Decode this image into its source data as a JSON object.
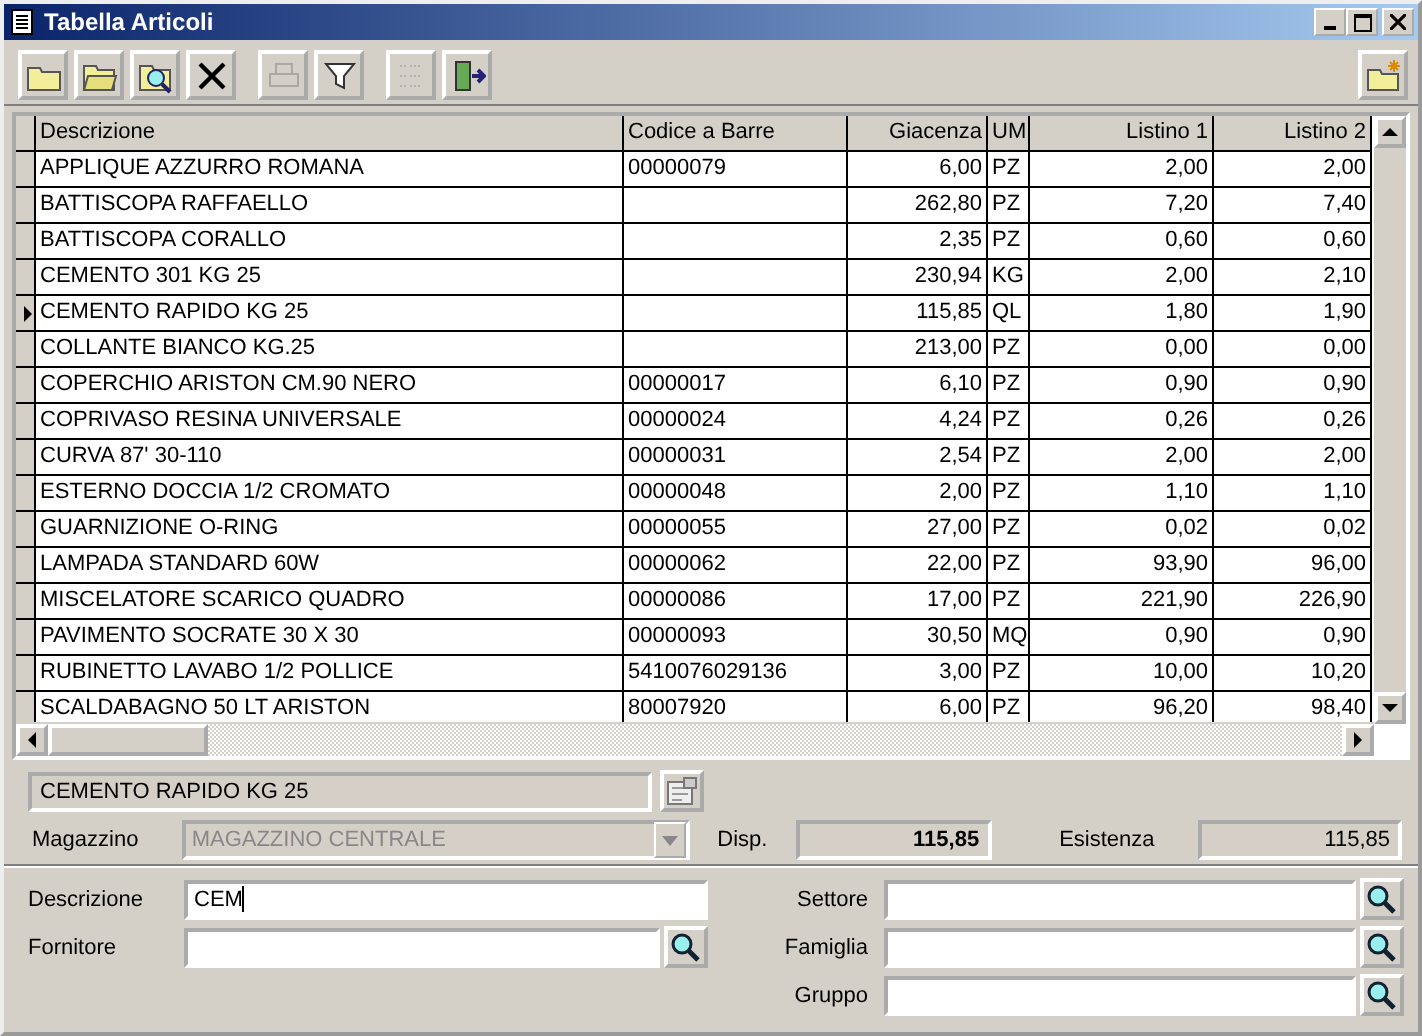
{
  "window": {
    "title": "Tabella Articoli"
  },
  "toolbar": [
    {
      "kind": "new",
      "disabled": false
    },
    {
      "kind": "open",
      "disabled": false
    },
    {
      "kind": "search",
      "disabled": false
    },
    {
      "kind": "delete",
      "disabled": false
    },
    {
      "kind": "print",
      "disabled": true
    },
    {
      "kind": "filter",
      "disabled": false
    },
    {
      "kind": "list",
      "disabled": true
    },
    {
      "kind": "exit",
      "disabled": false
    }
  ],
  "grid": {
    "columns": [
      {
        "label": "Descrizione"
      },
      {
        "label": "Codice a Barre"
      },
      {
        "label": "Giacenza"
      },
      {
        "label": "UM"
      },
      {
        "label": "Listino 1"
      },
      {
        "label": "Listino 2"
      }
    ],
    "rows": [
      {
        "selected": false,
        "cells": [
          "APPLIQUE AZZURRO ROMANA",
          "00000079",
          "6,00",
          "PZ",
          "2,00",
          "2,00"
        ]
      },
      {
        "selected": false,
        "cells": [
          "BATTISCOPA  RAFFAELLO",
          "",
          "262,80",
          "PZ",
          "7,20",
          "7,40"
        ]
      },
      {
        "selected": false,
        "cells": [
          "BATTISCOPA CORALLO",
          "",
          "2,35",
          "PZ",
          "0,60",
          "0,60"
        ]
      },
      {
        "selected": false,
        "cells": [
          "CEMENTO 301 KG 25",
          "",
          "230,94",
          "KG",
          "2,00",
          "2,10"
        ]
      },
      {
        "selected": true,
        "cells": [
          "CEMENTO RAPIDO KG 25",
          "",
          "115,85",
          "QL",
          "1,80",
          "1,90"
        ]
      },
      {
        "selected": false,
        "cells": [
          "COLLANTE BIANCO KG.25",
          "",
          "213,00",
          "PZ",
          "0,00",
          "0,00"
        ]
      },
      {
        "selected": false,
        "cells": [
          "COPERCHIO ARISTON CM.90 NERO",
          "00000017",
          "6,10",
          "PZ",
          "0,90",
          "0,90"
        ]
      },
      {
        "selected": false,
        "cells": [
          "COPRIVASO RESINA UNIVERSALE",
          "00000024",
          "4,24",
          "PZ",
          "0,26",
          "0,26"
        ]
      },
      {
        "selected": false,
        "cells": [
          "CURVA 87' 30-110",
          "00000031",
          "2,54",
          "PZ",
          "2,00",
          "2,00"
        ]
      },
      {
        "selected": false,
        "cells": [
          "ESTERNO DOCCIA 1/2 CROMATO",
          "00000048",
          "2,00",
          "PZ",
          "1,10",
          "1,10"
        ]
      },
      {
        "selected": false,
        "cells": [
          "GUARNIZIONE O-RING",
          "00000055",
          "27,00",
          "PZ",
          "0,02",
          "0,02"
        ]
      },
      {
        "selected": false,
        "cells": [
          "LAMPADA STANDARD 60W",
          "00000062",
          "22,00",
          "PZ",
          "93,90",
          "96,00"
        ]
      },
      {
        "selected": false,
        "cells": [
          "MISCELATORE SCARICO QUADRO",
          "00000086",
          "17,00",
          "PZ",
          "221,90",
          "226,90"
        ]
      },
      {
        "selected": false,
        "cells": [
          "PAVIMENTO SOCRATE 30 X 30",
          "00000093",
          "30,50",
          "MQ",
          "0,90",
          "0,90"
        ]
      },
      {
        "selected": false,
        "cells": [
          "RUBINETTO LAVABO 1/2 POLLICE",
          "5410076029136",
          "3,00",
          "PZ",
          "10,00",
          "10,20"
        ]
      },
      {
        "selected": false,
        "cells": [
          "SCALDABAGNO 50 LT ARISTON",
          "80007920",
          "6,00",
          "PZ",
          "96,20",
          "98,40"
        ]
      }
    ]
  },
  "detail": {
    "article": "CEMENTO RAPIDO KG 25",
    "magazzino_label": "Magazzino",
    "magazzino": {
      "value": "MAGAZZINO CENTRALE",
      "disabled": true
    },
    "disp_label": "Disp.",
    "disp": "115,85",
    "esistenza_label": "Esistenza",
    "esistenza": "115,85"
  },
  "filters_left": [
    {
      "label": "Descrizione",
      "value": "CEM",
      "lookup": false
    },
    {
      "label": "Fornitore",
      "lookup": true
    }
  ],
  "filters_right": [
    {
      "label": "Settore",
      "lookup": true
    },
    {
      "label": "Famiglia",
      "lookup": true
    },
    {
      "label": "Gruppo",
      "lookup": true
    }
  ]
}
